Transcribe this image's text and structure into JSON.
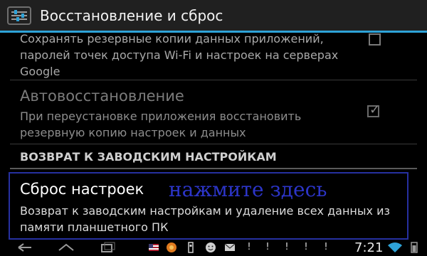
{
  "actionbar": {
    "title": "Восстановление и сброс",
    "icon": "settings-sliders-icon"
  },
  "backup": {
    "summary": "Сохранять резервные копии данных приложений, паролей точек доступа Wi-Fi и настроек на серверах Google",
    "checked": false
  },
  "autorestore": {
    "title": "Автовосстановление",
    "summary": "При переустановке приложения восстановить резервную копию настроек и данных",
    "checked": true,
    "enabled": false
  },
  "section": {
    "header": "ВОЗВРАТ К ЗАВОДСКИМ НАСТРОЙКАМ"
  },
  "reset": {
    "title": "Сброс настроек",
    "summary": "Возврат к заводским настройкам и удаление всех данных из памяти планшетного ПК"
  },
  "annotation": {
    "text": "нажмите здесь"
  },
  "systembar": {
    "clock": "7:21",
    "nav_icons": [
      "back-icon",
      "home-icon",
      "recent-apps-icon"
    ],
    "notification_icons": [
      "flag-icon",
      "browser-icon",
      "usb-icon",
      "smiley-icon",
      "mail-icon",
      "alert-icon",
      "alert-icon",
      "alert-icon",
      "alert-icon",
      "alert-icon"
    ],
    "status_icons": [
      "wifi-icon",
      "battery-icon"
    ]
  },
  "colors": {
    "accent": "#2ea3d8",
    "annotation": "#2c35c8"
  }
}
